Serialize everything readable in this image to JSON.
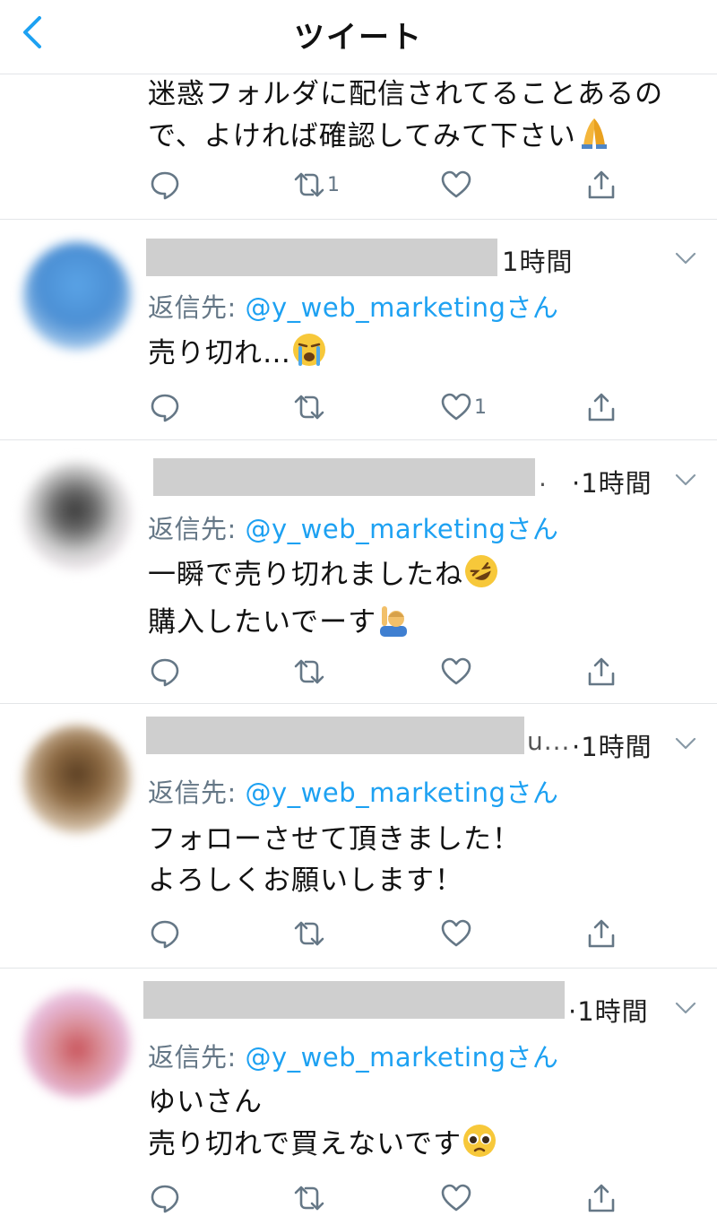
{
  "header": {
    "title": "ツイート"
  },
  "top_tweet": {
    "lines": [
      "迷惑フォルダに配信されてることあるの",
      "で、よければ確認してみて下さい"
    ],
    "emoji": "folded-hands-icon",
    "retweet_count": "1"
  },
  "replies": [
    {
      "time": "1時間",
      "name_suffix": "",
      "reply_prefix": "返信先: ",
      "reply_handle": "@y_web_marketing",
      "reply_suffix": "さん",
      "lines": [
        "売り切れ…"
      ],
      "like_count": "1"
    },
    {
      "time": "·1時間",
      "name_suffix": ".",
      "reply_prefix": "返信先: ",
      "reply_handle": "@y_web_marketing",
      "reply_suffix": "さん",
      "lines": [
        "一瞬で売り切れましたね",
        "購入したいでーす"
      ]
    },
    {
      "time": "·1時間",
      "name_suffix": "u...",
      "reply_prefix": "返信先: ",
      "reply_handle": "@y_web_marketing",
      "reply_suffix": "さん",
      "lines": [
        "フォローさせて頂きました！",
        "よろしくお願いします！"
      ]
    },
    {
      "time": "·1時間",
      "name_suffix": "",
      "reply_prefix": "返信先: ",
      "reply_handle": "@y_web_marketing",
      "reply_suffix": "さん",
      "lines": [
        "ゆいさん",
        "売り切れで買えないです"
      ]
    }
  ],
  "colors": {
    "accent": "#1da1f2",
    "muted": "#657786",
    "divider": "#e3e5e8"
  }
}
